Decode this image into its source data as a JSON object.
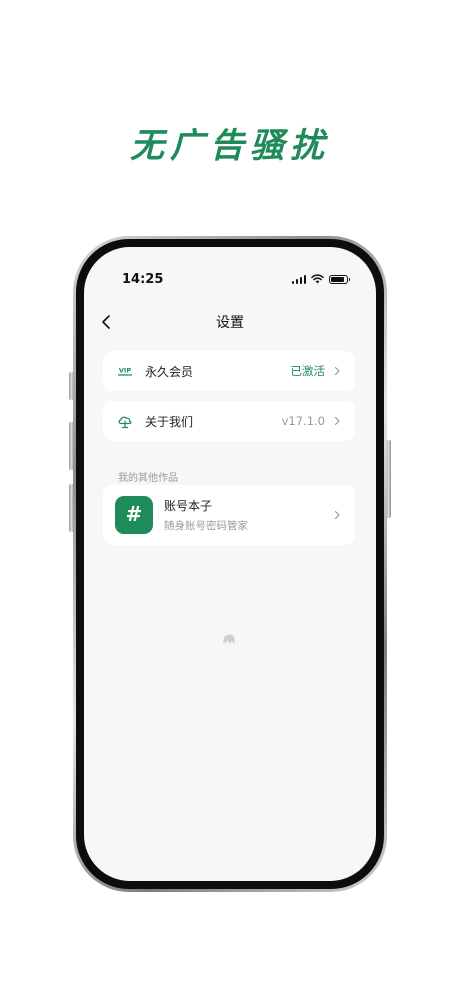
{
  "headline": "无广告骚扰",
  "colors": {
    "brand": "#1f8a5a",
    "app_icon_bg": "#1f8a5a",
    "muted_text": "#9a9a9a",
    "screen_bg": "#f7f7f7"
  },
  "status_bar": {
    "time": "14:25",
    "icons": [
      "cellular-signal-icon",
      "wifi-icon",
      "battery-icon"
    ]
  },
  "nav": {
    "back_icon": "chevron-left-icon",
    "title": "设置"
  },
  "settings": [
    {
      "icon": "vip-icon",
      "icon_text": "VIP",
      "label": "永久会员",
      "value": "已激活"
    },
    {
      "icon": "cloud-tree-icon",
      "label": "关于我们",
      "value": "v17.1.0"
    }
  ],
  "other_works": {
    "section_label": "我的其他作品",
    "apps": [
      {
        "icon": "hash-icon",
        "icon_glyph": "#",
        "name": "账号本子",
        "description": "随身账号密码管家"
      }
    ]
  },
  "footer": {
    "icon": "elephant-icon"
  }
}
